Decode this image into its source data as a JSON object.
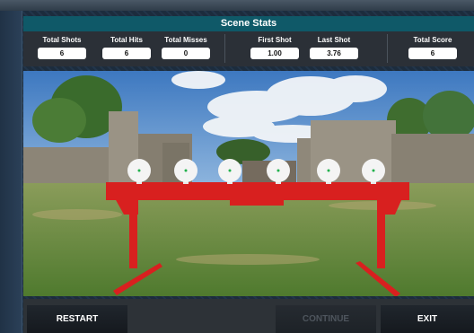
{
  "title": "Scene Stats",
  "stats": {
    "total_shots": {
      "label": "Total Shots",
      "value": "6"
    },
    "total_hits": {
      "label": "Total Hits",
      "value": "6"
    },
    "total_misses": {
      "label": "Total Misses",
      "value": "0"
    },
    "first_shot": {
      "label": "First Shot",
      "value": "1.00"
    },
    "last_shot": {
      "label": "Last Shot",
      "value": "3.76"
    },
    "total_score": {
      "label": "Total Score",
      "value": "6"
    }
  },
  "buttons": {
    "restart": "RESTART",
    "continue": "CONTINUE",
    "exit": "EXIT"
  },
  "colors": {
    "header": "#0f5968",
    "target_stand": "#d8201f",
    "hit_marker": "#22b14c"
  }
}
